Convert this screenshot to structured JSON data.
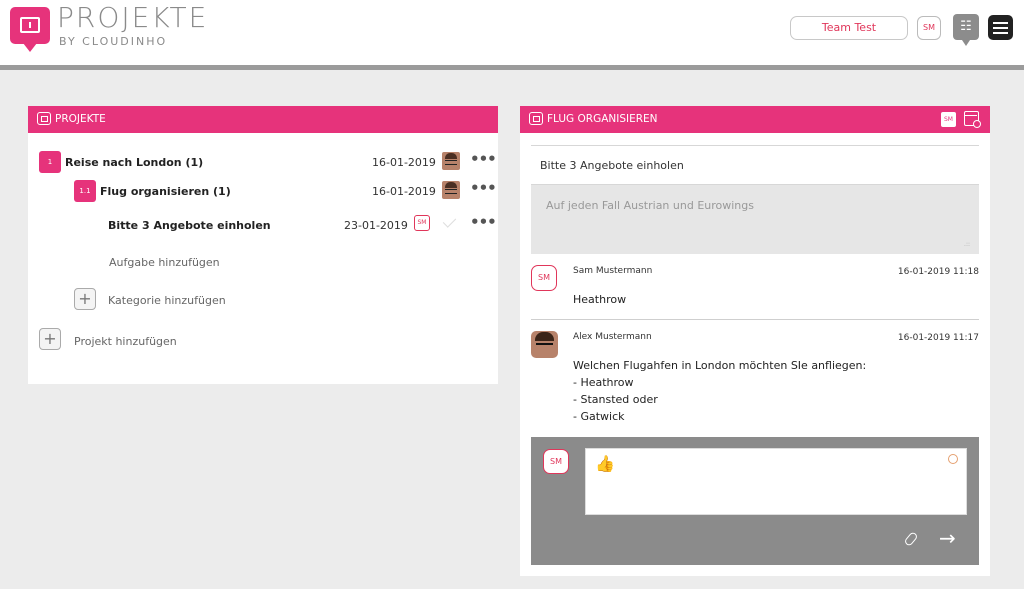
{
  "header": {
    "brand_title": "PROJEKTE",
    "brand_subtitle": "BY CLOUDINHO",
    "team_button": "Team Test",
    "user_initials": "SM",
    "team_icon": "people-icon",
    "menu_icon": "hamburger-icon"
  },
  "left_panel": {
    "title": "PROJEKTE",
    "items": [
      {
        "number": "1",
        "label": "Reise nach London (1)",
        "date": "16-01-2019",
        "avatar": "user-photo",
        "more": "•••"
      },
      {
        "number": "1.1",
        "label": "Flug organisieren (1)",
        "date": "16-01-2019",
        "avatar": "user-photo",
        "more": "•••"
      },
      {
        "label": "Bitte 3 Angebote einholen",
        "date": "23-01-2019",
        "assignee": "SM",
        "more": "•••"
      }
    ],
    "add_task": "Aufgabe hinzufügen",
    "add_category": "Kategorie hinzufügen",
    "add_project": "Projekt hinzufügen",
    "plus": "+"
  },
  "right_panel": {
    "title": "FLUG ORGANISIEREN",
    "assignee": "SM",
    "task_title": "Bitte 3 Angebote einholen",
    "description": "Auf jeden Fall Austrian und Eurowings",
    "resize_mark": ".::",
    "comments": [
      {
        "initials": "SM",
        "author": "Sam Mustermann",
        "time": "16-01-2019 11:18",
        "lines": [
          "Heathrow"
        ]
      },
      {
        "author": "Alex Mustermann",
        "time": "16-01-2019 11:17",
        "lines": [
          "Welchen Flugahfen in London möchten SIe anfliegen:",
          "- Heathrow",
          "- Stansted oder",
          "- Gatwick"
        ]
      }
    ],
    "reply": {
      "initials": "SM",
      "thumb": "👍",
      "send": "→"
    }
  },
  "colors": {
    "accent": "#e6337b",
    "header_line": "#9b9b9b",
    "background": "#ececec",
    "reply_area": "#8b8b8b"
  }
}
